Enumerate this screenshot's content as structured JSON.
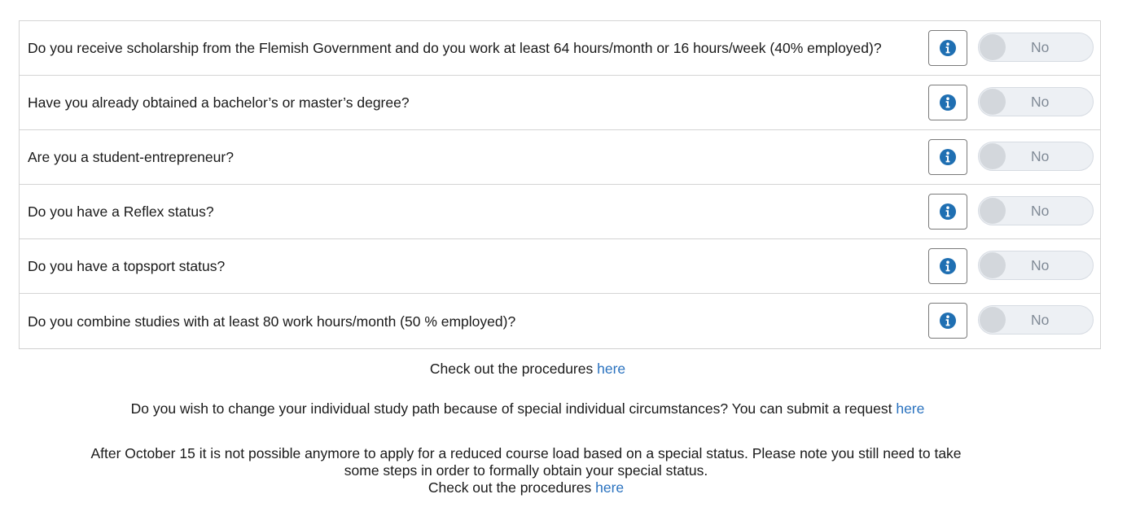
{
  "questions": [
    {
      "text": "Do you receive scholarship from the Flemish Government and do you work at least 64 hours/month or 16 hours/week (40% employed)?",
      "toggle": "No"
    },
    {
      "text": "Have you already obtained a bachelor’s or master’s degree?",
      "toggle": "No"
    },
    {
      "text": "Are you a student-entrepreneur?",
      "toggle": "No"
    },
    {
      "text": "Do you have a Reflex status?",
      "toggle": "No"
    },
    {
      "text": "Do you have a topsport status?",
      "toggle": "No"
    },
    {
      "text": "Do you combine studies with at least 80 work hours/month (50 % employed)?",
      "toggle": "No"
    }
  ],
  "info_icon": "info-circle-icon",
  "colors": {
    "info_icon": "#1f6fb2",
    "link": "#2a72bf",
    "toggle_bg": "#edf0f4",
    "toggle_knob": "#d3d7dc",
    "toggle_text": "#808a96"
  },
  "footer": {
    "procedures_text": "Check out the procedures",
    "procedures_link": "here",
    "individual_path_text": "Do you wish to change your individual study path because of special individual circumstances? You can submit a request",
    "individual_path_link": "here",
    "deadline_line1": "After October 15 it is not possible anymore to apply for a reduced course load based on a special status. Please note you still need to take",
    "deadline_line2": "some steps in order to formally obtain your special status.",
    "deadline_procedures_text": "Check out the procedures",
    "deadline_procedures_link": "here"
  }
}
